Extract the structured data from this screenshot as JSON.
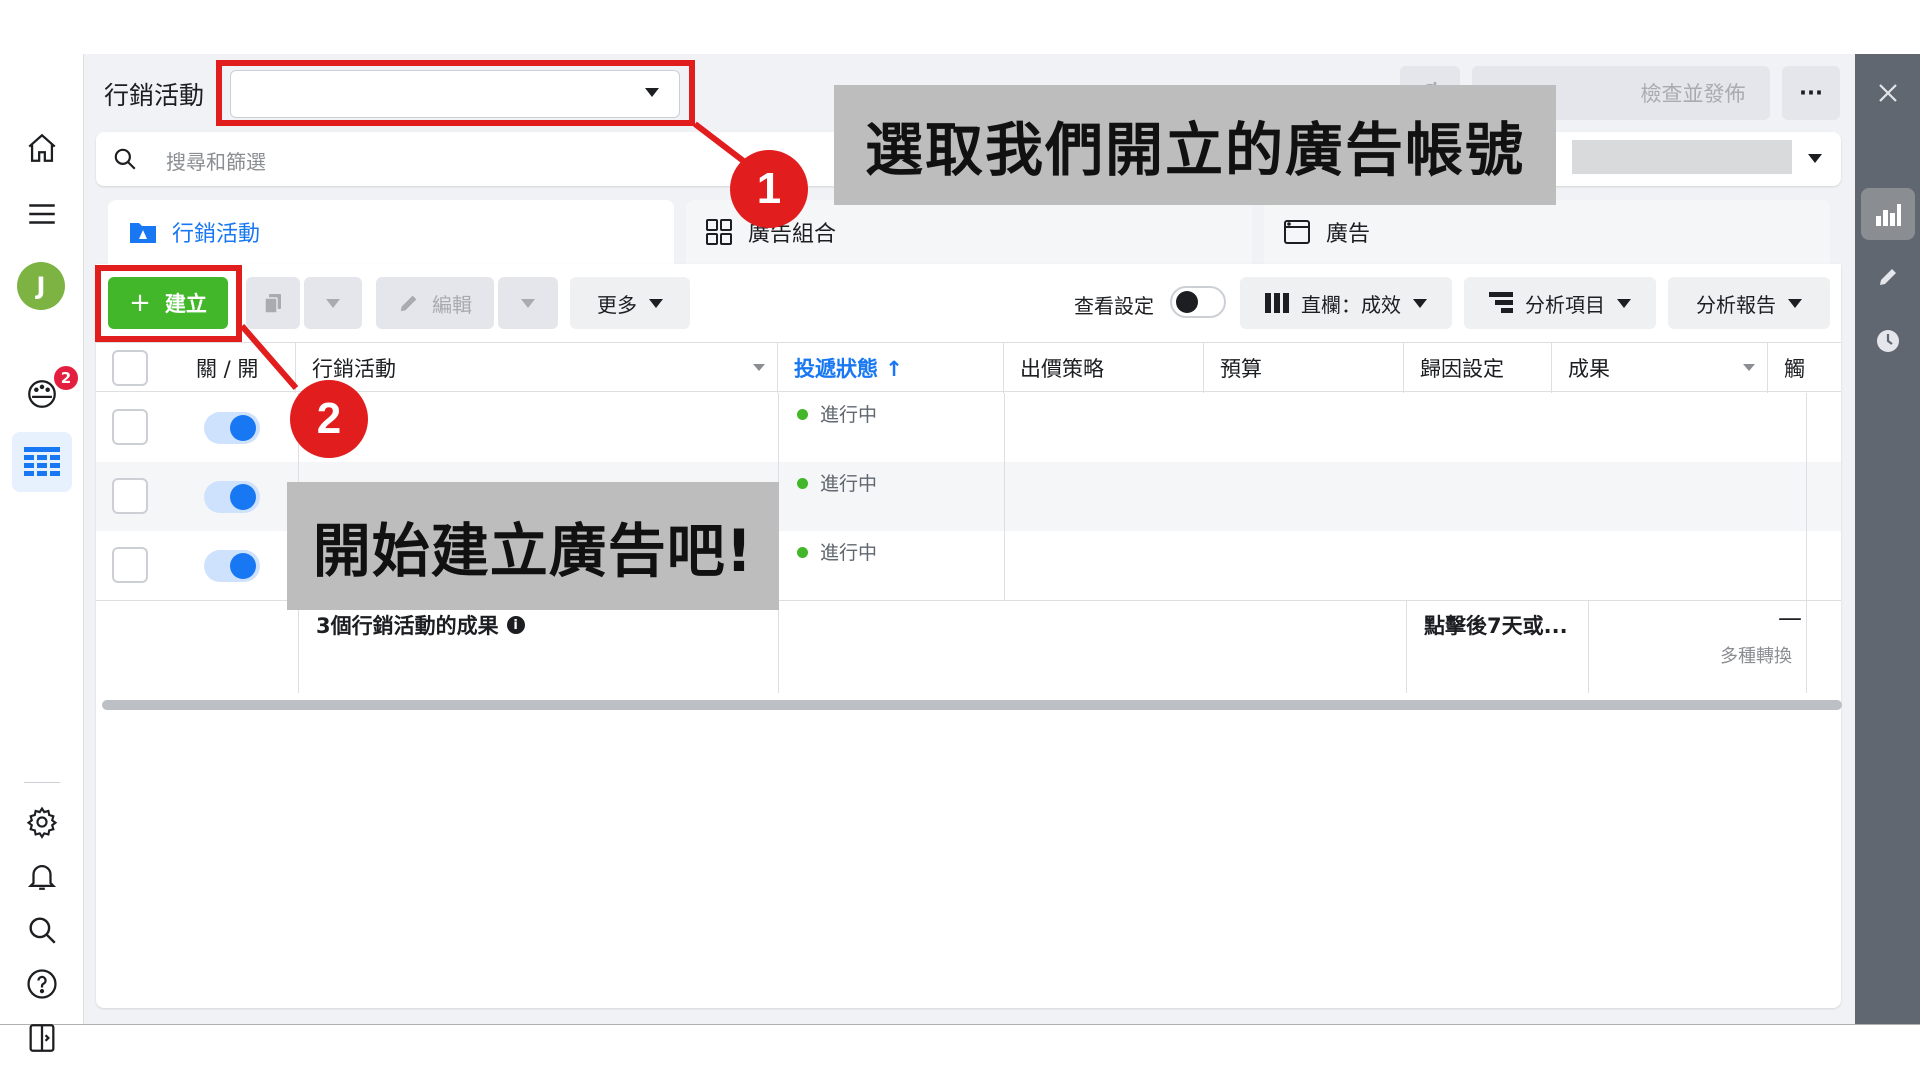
{
  "header": {
    "title": "行銷活動",
    "account_selector_value": "",
    "publish_button": "檢查並發佈",
    "more_button": "···"
  },
  "search": {
    "placeholder": "搜尋和篩選"
  },
  "tabs": [
    {
      "label": "行銷活動",
      "active": true
    },
    {
      "label": "廣告組合",
      "active": false
    },
    {
      "label": "廣告",
      "active": false
    }
  ],
  "toolbar": {
    "create_label": "建立",
    "edit_label": "編輯",
    "more_label": "更多",
    "view_settings_label": "查看設定",
    "columns_label": "直欄：成效",
    "breakdown_label": "分析項目",
    "reports_label": "分析報告"
  },
  "table": {
    "columns": [
      "關 / 開",
      "行銷活動",
      "投遞狀態 ↑",
      "出價策略",
      "預算",
      "歸因設定",
      "成果",
      "觸"
    ],
    "rows": [
      {
        "status": "進行中",
        "on": true
      },
      {
        "status": "進行中",
        "on": true
      },
      {
        "status": "進行中",
        "on": true
      }
    ],
    "summary": {
      "title": "3個行銷活動的成果",
      "attribution": "點擊後7天或...",
      "result": "—",
      "result_sub": "多種轉換"
    }
  },
  "left_rail": {
    "avatar_letter": "J",
    "notification_count": "2"
  },
  "annotations": {
    "callout_1": "選取我們開立的廣告帳號",
    "callout_2": "開始建立廣告吧!",
    "badge_1": "1",
    "badge_2": "2",
    "color": "#e11d1d"
  },
  "colors": {
    "accent": "#1877f2",
    "create_green": "#42b72a",
    "status_green": "#42b72a"
  }
}
